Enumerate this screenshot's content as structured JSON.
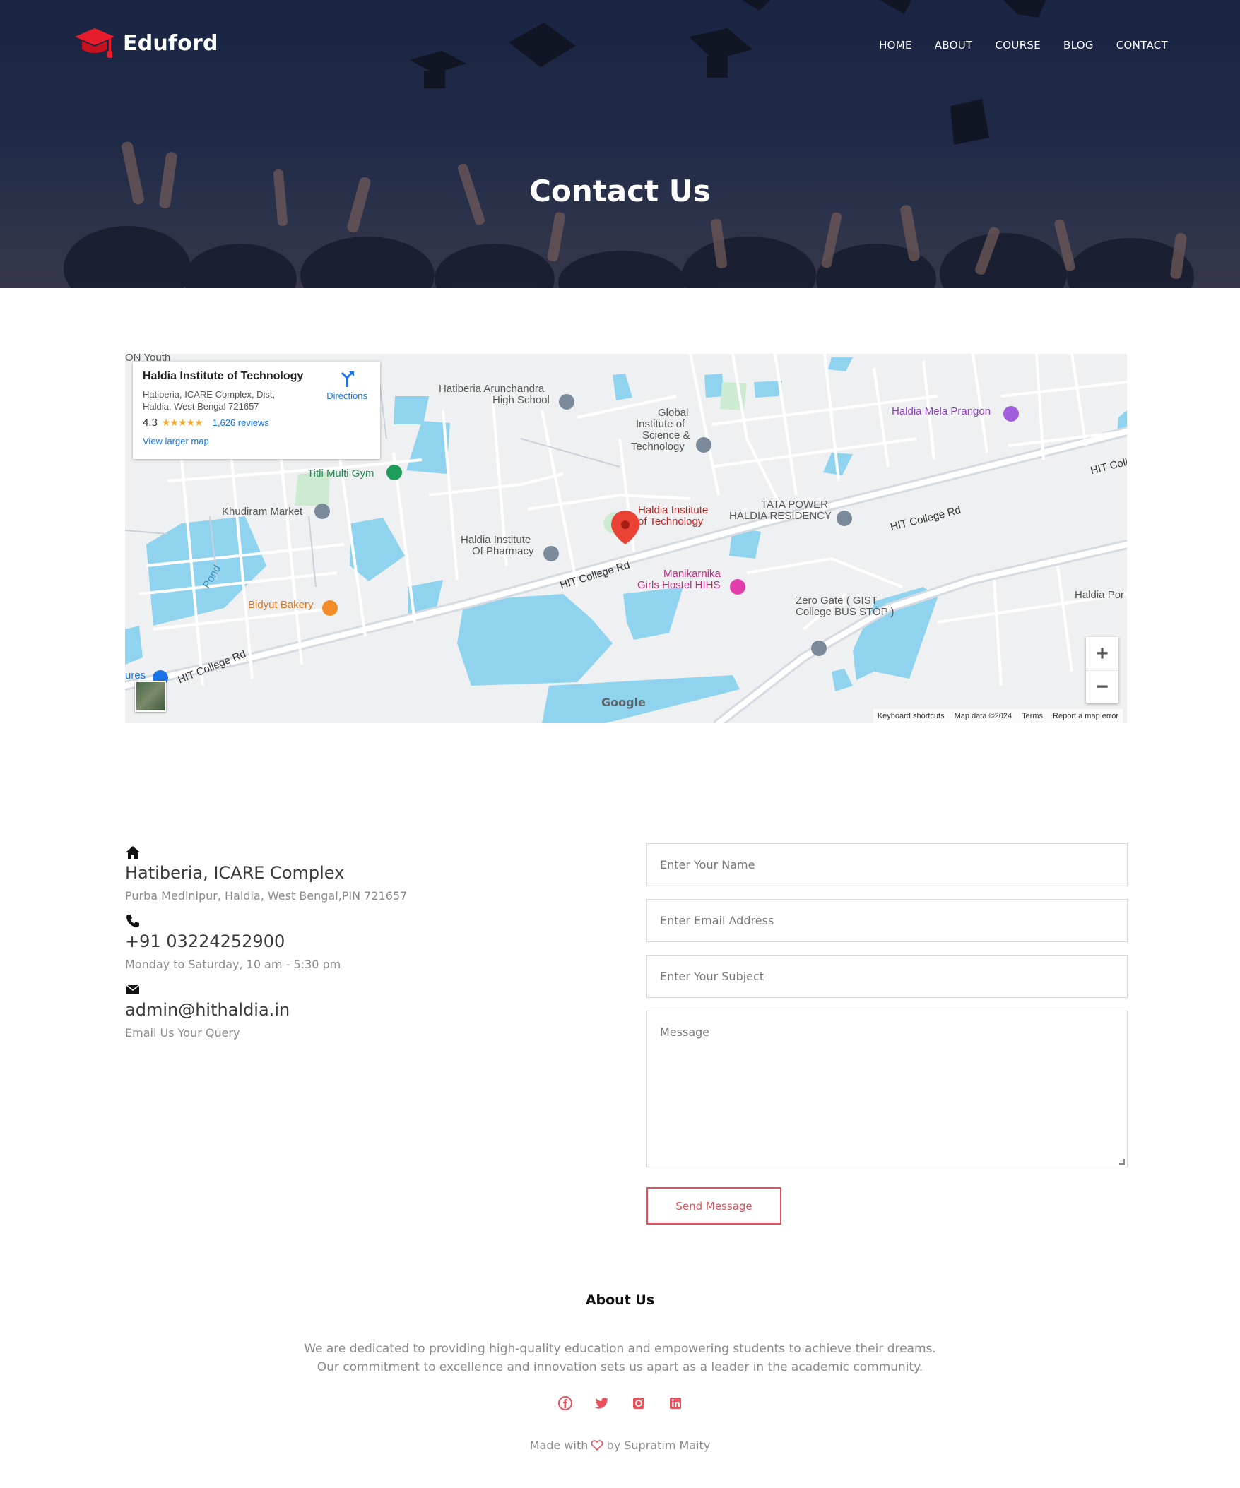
{
  "brand": {
    "name": "Eduford"
  },
  "nav": [
    {
      "label": "HOME"
    },
    {
      "label": "ABOUT"
    },
    {
      "label": "COURSE"
    },
    {
      "label": "BLOG"
    },
    {
      "label": "CONTACT"
    }
  ],
  "hero": {
    "title": "Contact Us"
  },
  "map": {
    "card": {
      "title": "Haldia Institute of Technology",
      "address": "Hatiberia, ICARE Complex, Dist, Haldia, West Bengal 721657",
      "rating": "4.3",
      "stars": "★★★★★",
      "reviews": "1,626 reviews",
      "larger_map": "View larger map",
      "directions": "Directions"
    },
    "labels": {
      "youth": "ON Youth",
      "arunchandra": "Hatiberia Arunchandra",
      "arunchandra2": "High School",
      "gist": "Global",
      "gist2": "Institute of",
      "gist3": "Science &",
      "gist4": "Technology",
      "mela": "Haldia Mela Prangon",
      "titli": "Titli Multi Gym",
      "khudiram": "Khudiram Market",
      "hit": "Haldia Institute",
      "hit2": "of Technology",
      "tata": "TATA POWER",
      "tata2": "HALDIA RESIDENCY",
      "pharmacy": "Haldia Institute",
      "pharmacy2": "Of Pharmacy",
      "pond": "Pond",
      "manikarnika": "Manikarnika",
      "manikarnika2": "Girls Hostel HIHS",
      "bidyut": "Bidyut Bakery",
      "zero": "Zero Gate ( GIST",
      "zero2": "College BUS STOP )",
      "haldia_por": "Haldia Por",
      "hit_college_rd": "HIT College Rd",
      "hit_col": "HIT Coll",
      "ures": "ures"
    },
    "google": "Google",
    "footer": {
      "shortcuts": "Keyboard shortcuts",
      "mapdata": "Map data ©2024",
      "terms": "Terms",
      "report": "Report a map error"
    },
    "zoom_in": "+",
    "zoom_out": "−"
  },
  "contact": {
    "address_main": "Hatiberia, ICARE Complex",
    "address_sub": "Purba Medinipur, Haldia, West Bengal,PIN 721657",
    "phone_main": "+91 03224252900",
    "phone_sub": "Monday to Saturday, 10 am - 5:30 pm",
    "email_main": "admin@hithaldia.in",
    "email_sub": "Email Us Your Query"
  },
  "form": {
    "name_placeholder": "Enter Your Name",
    "email_placeholder": "Enter Email Address",
    "subject_placeholder": "Enter Your Subject",
    "message_placeholder": "Message",
    "send_label": "Send Message"
  },
  "footer": {
    "about_title": "About Us",
    "about_line1": "We are dedicated to providing high-quality education and empowering students to achieve their dreams.",
    "about_line2": "Our commitment to excellence and innovation sets us apart as a leader in the academic community.",
    "made_prefix": "Made with",
    "made_suffix": "by Supratim Maity"
  },
  "colors": {
    "accent": "#e8505b",
    "hero_bg": "#26314f",
    "water": "#8fd3ee"
  },
  "icons": [
    "graduation-cap-icon",
    "home-icon",
    "phone-icon",
    "envelope-icon",
    "facebook-icon",
    "twitter-icon",
    "instagram-icon",
    "linkedin-icon",
    "heart-icon",
    "directions-icon",
    "location-pin-icon"
  ]
}
